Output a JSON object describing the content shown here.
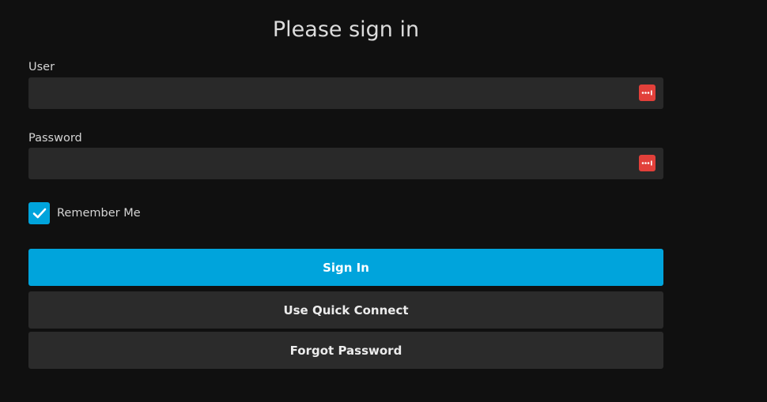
{
  "form": {
    "title": "Please sign in",
    "user": {
      "label": "User",
      "value": "",
      "icon": "password-manager-icon"
    },
    "password": {
      "label": "Password",
      "value": "",
      "icon": "password-manager-icon"
    },
    "remember_me": {
      "label": "Remember Me",
      "checked": true
    },
    "buttons": {
      "sign_in": "Sign In",
      "quick_connect": "Use Quick Connect",
      "forgot_password": "Forgot Password"
    }
  },
  "colors": {
    "background": "#101010",
    "input_background": "#292929",
    "accent": "#00a4dc",
    "secondary_button": "#2b2b2b",
    "password_manager_icon": "#e2403a"
  }
}
